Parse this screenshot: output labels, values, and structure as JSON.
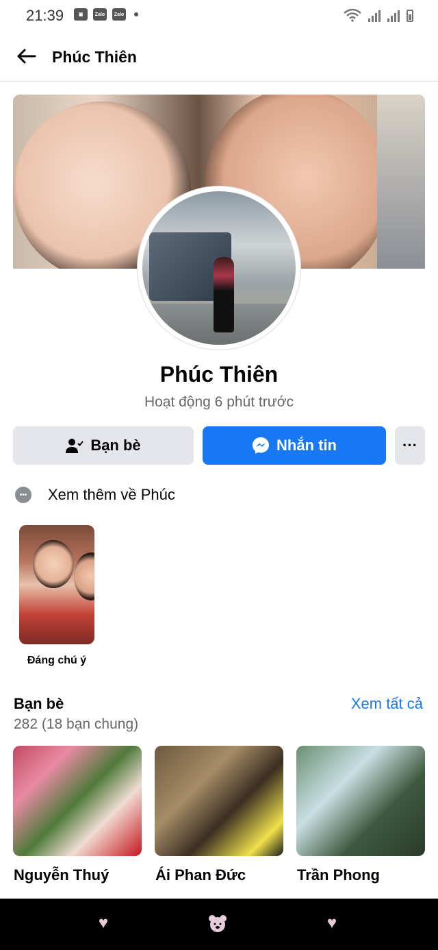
{
  "status_bar": {
    "time": "21:39",
    "left_icons": [
      "image-icon",
      "zalo-icon",
      "zalo-icon",
      "dot-icon"
    ],
    "zalo_label": "Zalo",
    "right_icons": [
      "wifi-icon",
      "signal-icon",
      "signal-icon",
      "battery-icon"
    ]
  },
  "header": {
    "back_icon": "arrow-left-icon",
    "title": "Phúc Thiên"
  },
  "profile": {
    "name": "Phúc Thiên",
    "activity": "Hoạt động 6 phút trước"
  },
  "actions": {
    "friends_label": "Bạn bè",
    "friends_icon": "person-check-icon",
    "message_label": "Nhắn tin",
    "message_icon": "messenger-icon",
    "more_label": "···"
  },
  "more_about": {
    "icon": "more-dots-icon",
    "label": "Xem thêm về Phúc"
  },
  "featured": {
    "label": "Đáng chú ý"
  },
  "friends": {
    "title": "Bạn bè",
    "see_all": "Xem tất cả",
    "count": "282 (18 bạn chung)",
    "items": [
      {
        "name": "Nguyễn Thuý"
      },
      {
        "name": "Ái Phan Đức"
      },
      {
        "name": "Trần Phong"
      }
    ]
  },
  "navbar": {
    "icons": [
      "heart-icon",
      "bear-icon",
      "heart-icon"
    ]
  },
  "colors": {
    "accent": "#1877f2",
    "secondary_button": "#e4e6eb",
    "muted_text": "#65676b"
  }
}
